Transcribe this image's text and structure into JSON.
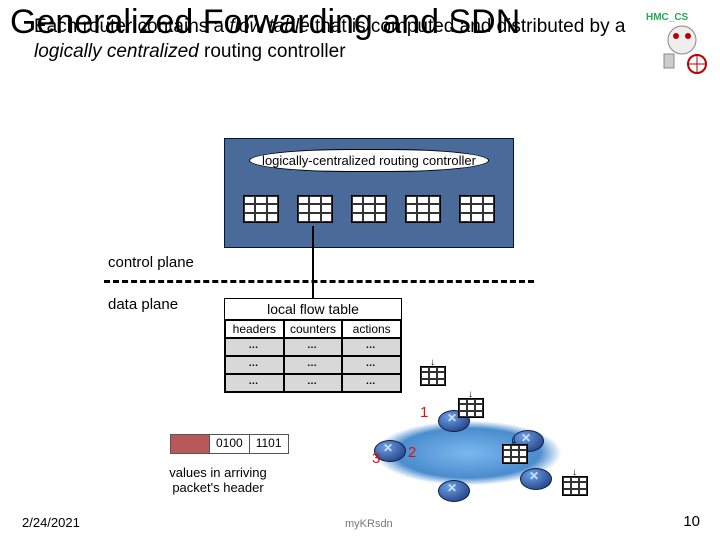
{
  "title": "Generalized Forwarding and SDN",
  "subtitle_parts": {
    "a": "Each router contains a ",
    "b": "flow table",
    "c": " that is computed and distributed by a ",
    "d": "logically centralized",
    "e": " routing controller"
  },
  "controller_label": "logically-centralized routing controller",
  "control_plane": "control plane",
  "data_plane": "data plane",
  "flow_table": {
    "title": "local flow table",
    "headers": [
      "headers",
      "counters",
      "actions"
    ],
    "rows": [
      [
        "…",
        "…",
        "…"
      ],
      [
        "…",
        "…",
        "…"
      ],
      [
        "…",
        "…",
        "…"
      ]
    ]
  },
  "packet": {
    "c1": "0100",
    "c2": "1101"
  },
  "packet_caption": "values in arriving packet's header",
  "nums": {
    "n1": "1",
    "n2": "2",
    "n3": "3"
  },
  "footer": {
    "date": "2/24/2021",
    "note": "myKRsdn",
    "page": "10"
  },
  "logo_text": "HMC_CS"
}
